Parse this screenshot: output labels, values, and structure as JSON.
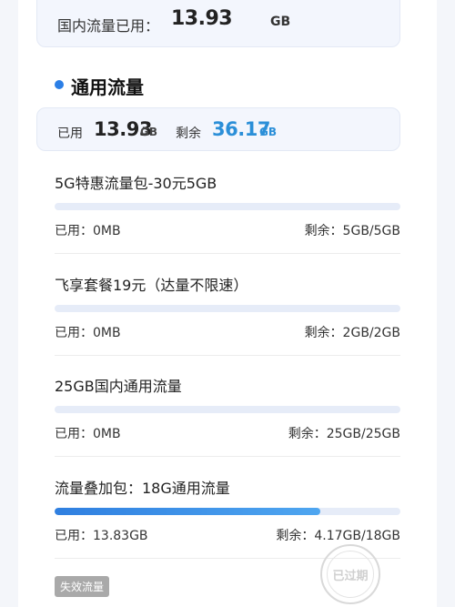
{
  "domestic_summary": {
    "label": "国内流量已用：",
    "value": "13.93",
    "unit": "GB"
  },
  "general": {
    "title": "通用流量",
    "used_label": "已用",
    "used_value": "13.93",
    "used_unit": "GB",
    "remain_label": "剩余",
    "remain_value": "36.17",
    "remain_unit": "GB"
  },
  "packages": [
    {
      "name": "5G特惠流量包-30元5GB",
      "used": "已用：0MB",
      "remain": "剩余：5GB/5GB",
      "used_fraction": 0
    },
    {
      "name": "飞享套餐19元（达量不限速）",
      "used": "已用：0MB",
      "remain": "剩余：2GB/2GB",
      "used_fraction": 0
    },
    {
      "name": "25GB国内通用流量",
      "used": "已用：0MB",
      "remain": "剩余：25GB/25GB",
      "used_fraction": 0
    },
    {
      "name": "流量叠加包：18G通用流量",
      "used": "已用：13.83GB",
      "remain": "剩余：4.17GB/18GB",
      "used_fraction": 0.768
    }
  ],
  "expired_badge": "失效流量",
  "expired_stamp": "已过期",
  "colors": {
    "accent": "#2b7fe6",
    "remain_highlight": "#2b8fd8",
    "track": "#e6ecf8"
  }
}
